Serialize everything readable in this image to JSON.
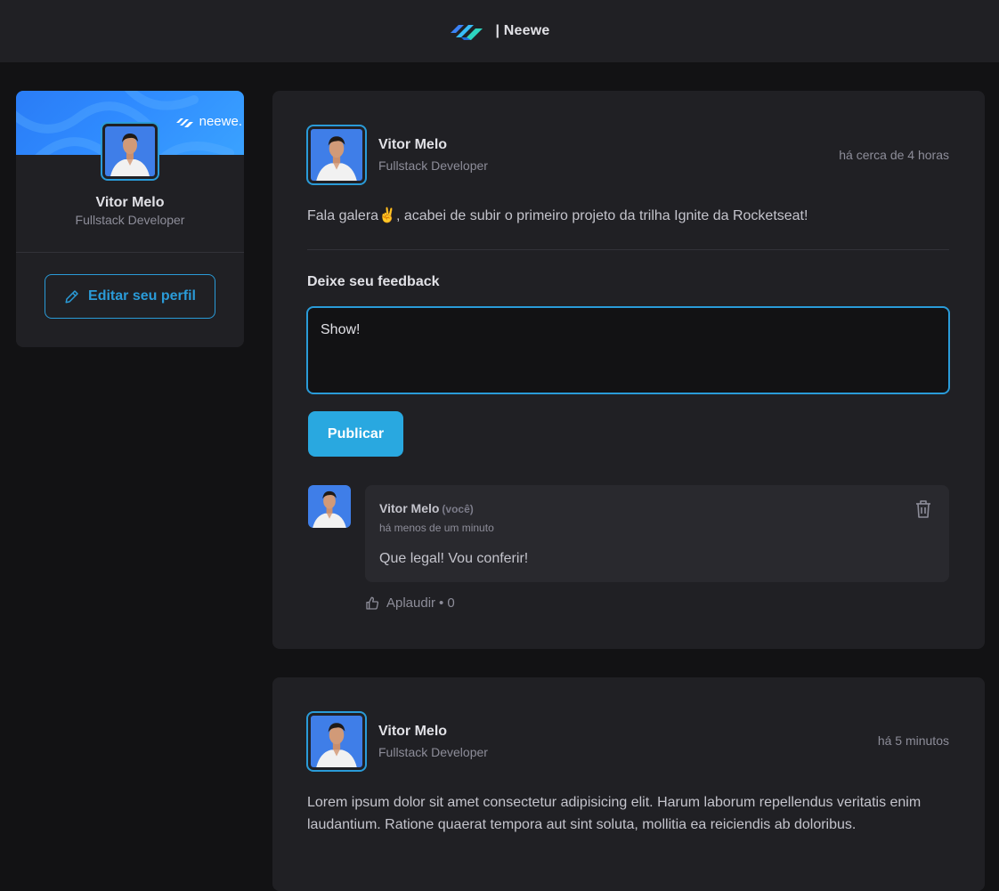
{
  "header": {
    "brand_text": "| Neewe"
  },
  "sidebar": {
    "cover_brand": "neewe.",
    "name": "Vitor Melo",
    "role": "Fullstack Developer",
    "edit_label": "Editar seu perfil"
  },
  "posts": [
    {
      "author": "Vitor Melo",
      "role": "Fullstack Developer",
      "time": "há cerca de 4 horas",
      "content": "Fala galera✌️, acabei de subir o primeiro projeto da trilha Ignite da Rocketseat!",
      "feedback_title": "Deixe seu feedback",
      "feedback_value": "Show!",
      "publish_label": "Publicar",
      "comment": {
        "author": "Vitor Melo",
        "you_label": "(você)",
        "time": "há menos de um minuto",
        "text": "Que legal! Vou conferir!",
        "applaud_label": "Aplaudir",
        "applaud_sep": "•",
        "applaud_count": "0"
      }
    },
    {
      "author": "Vitor Melo",
      "role": "Fullstack Developer",
      "time": "há 5 minutos",
      "content": "Lorem ipsum dolor sit amet consectetur adipisicing elit. Harum laborum repellendus veritatis enim laudantium. Ratione quaerat tempora aut sint soluta, mollitia ea reiciendis ab doloribus."
    }
  ],
  "colors": {
    "accent": "#2a9bd8",
    "button": "#29a8e0",
    "background": "#121214",
    "surface": "#202024",
    "comment_surface": "#29292e"
  },
  "icons": {
    "brand": "neewe-logo-icon",
    "edit": "pencil-icon",
    "delete": "trash-icon",
    "applaud": "thumbs-up-icon"
  }
}
